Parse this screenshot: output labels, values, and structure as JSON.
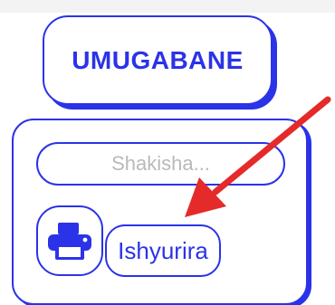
{
  "header": {
    "title": "UMUGABANE"
  },
  "search": {
    "placeholder": "Shakisha..."
  },
  "print": {
    "icon": "printer-icon",
    "label": "Ishyurira"
  },
  "colors": {
    "accent": "#2b33e8",
    "annotation_arrow": "#e52a2a",
    "background": "#ffffff"
  }
}
